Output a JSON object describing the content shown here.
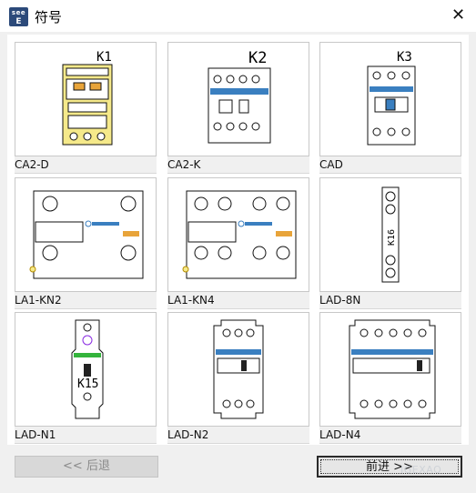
{
  "window": {
    "title": "符号",
    "app_icon_line1": "see",
    "app_icon_line2": "E"
  },
  "symbols": [
    {
      "label": "CA2-D",
      "tag": "K1",
      "kind": "contactor-yellow"
    },
    {
      "label": "CA2-K",
      "tag": "K2",
      "kind": "contactor-grey"
    },
    {
      "label": "CAD",
      "tag": "K3",
      "kind": "contactor-narrow"
    },
    {
      "label": "LA1-KN2",
      "tag": "",
      "kind": "aux-block-2"
    },
    {
      "label": "LA1-KN4",
      "tag": "",
      "kind": "aux-block-4"
    },
    {
      "label": "LAD-8N",
      "tag": "K16",
      "kind": "slim-vertical"
    },
    {
      "label": "LAD-N1",
      "tag": "K15",
      "kind": "slim-module"
    },
    {
      "label": "LAD-N2",
      "tag": "",
      "kind": "front-2"
    },
    {
      "label": "LAD-N4",
      "tag": "",
      "kind": "front-4"
    }
  ],
  "nav": {
    "prev_label": "<<  后退",
    "next_label": "前进  >>"
  },
  "watermark": "IGEXAO",
  "colors": {
    "yellow": "#f5e98a",
    "brand_blue": "#3a7fc0",
    "green": "#34b43c",
    "orange": "#e8a43a"
  }
}
